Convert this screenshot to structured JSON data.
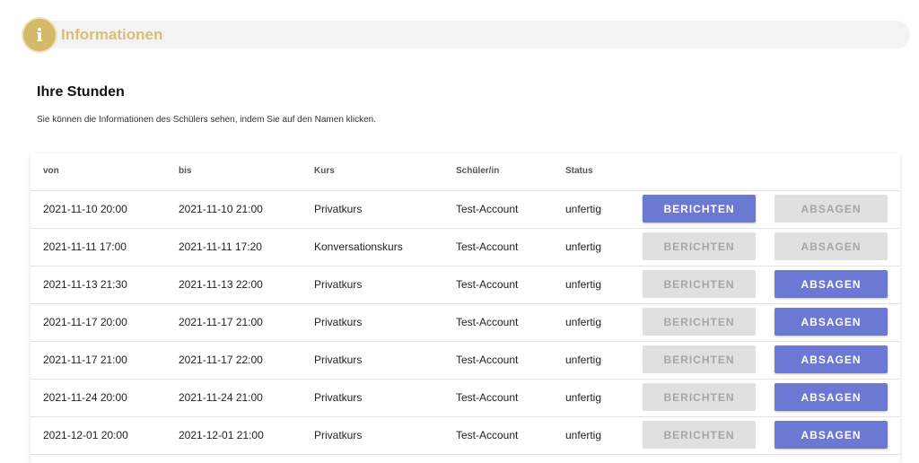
{
  "info": {
    "icon": "info-icon",
    "icon_glyph": "i",
    "title": "Informationen"
  },
  "section": {
    "title": "Ihre Stunden",
    "subtitle": "Sie können die Informationen des Schülers sehen, indem Sie auf den Namen klicken."
  },
  "table": {
    "headers": [
      "von",
      "bis",
      "Kurs",
      "Schüler/in",
      "Status"
    ],
    "report_label": "BERICHTEN",
    "cancel_label": "ABSAGEN",
    "rows": [
      {
        "von": "2021-11-10 20:00",
        "bis": "2021-11-10 21:00",
        "kurs": "Privatkurs",
        "schueler": "Test-Account",
        "status": "unfertig",
        "report_enabled": true,
        "cancel_enabled": false
      },
      {
        "von": "2021-11-11 17:00",
        "bis": "2021-11-11 17:20",
        "kurs": "Konversationskurs",
        "schueler": "Test-Account",
        "status": "unfertig",
        "report_enabled": false,
        "cancel_enabled": false
      },
      {
        "von": "2021-11-13 21:30",
        "bis": "2021-11-13 22:00",
        "kurs": "Privatkurs",
        "schueler": "Test-Account",
        "status": "unfertig",
        "report_enabled": false,
        "cancel_enabled": true
      },
      {
        "von": "2021-11-17 20:00",
        "bis": "2021-11-17 21:00",
        "kurs": "Privatkurs",
        "schueler": "Test-Account",
        "status": "unfertig",
        "report_enabled": false,
        "cancel_enabled": true
      },
      {
        "von": "2021-11-17 21:00",
        "bis": "2021-11-17 22:00",
        "kurs": "Privatkurs",
        "schueler": "Test-Account",
        "status": "unfertig",
        "report_enabled": false,
        "cancel_enabled": true
      },
      {
        "von": "2021-11-24 20:00",
        "bis": "2021-11-24 21:00",
        "kurs": "Privatkurs",
        "schueler": "Test-Account",
        "status": "unfertig",
        "report_enabled": false,
        "cancel_enabled": true
      },
      {
        "von": "2021-12-01 20:00",
        "bis": "2021-12-01 21:00",
        "kurs": "Privatkurs",
        "schueler": "Test-Account",
        "status": "unfertig",
        "report_enabled": false,
        "cancel_enabled": true
      }
    ]
  },
  "colors": {
    "accent": "#6b79d4",
    "info_gold": "#d4b96a",
    "disabled_bg": "#e0e0e0",
    "disabled_text": "#a6a6a6"
  }
}
